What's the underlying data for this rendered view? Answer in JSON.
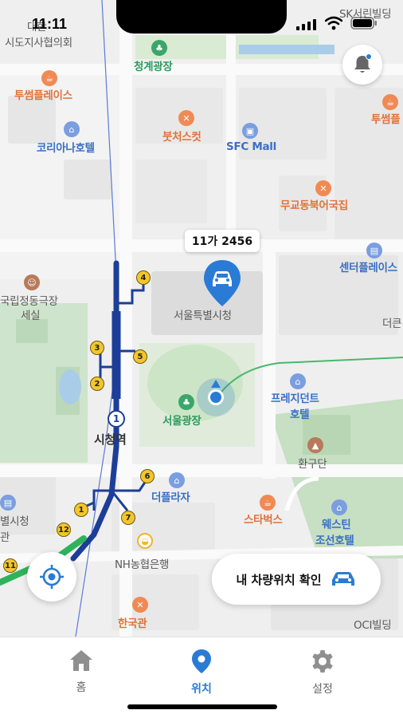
{
  "status_bar": {
    "time": "11:11"
  },
  "map": {
    "labels": {
      "daehan": "대한",
      "assoc": "시도지사협의회",
      "sk": "SK서린빌딩",
      "cheonggye": "청계광장",
      "tussom1": "투썸플레이스",
      "tussom2": "투썸플",
      "koreana": "코리아나호텔",
      "butcher": "붓처스컷",
      "sfc": "SFC Mall",
      "mugyo": "무교동북어국집",
      "center_place": "센터플레이스",
      "deoken": "더큰",
      "jeongdong1": "국립정동극장",
      "jeongdong2": "세실",
      "cityhall": "서울특별시청",
      "plaza": "서울광장",
      "station": "시청역",
      "line1": "1호선",
      "president1": "프레지던트",
      "president2": "호텔",
      "hwangudan": "환구단",
      "deplaza": "더플라자",
      "starbucks": "스타벅스",
      "westin1": "웨스틴",
      "westin2": "조선호텔",
      "cityhall_left1": "별시청",
      "cityhall_left2": "관",
      "nh": "NH농협은행",
      "hanguk": "한국관",
      "oci": "OCI빌딩"
    },
    "exits": [
      "4",
      "3",
      "5",
      "2",
      "6",
      "1",
      "7",
      "12",
      "11"
    ],
    "station_number": "1"
  },
  "car": {
    "plate": "11가 2456"
  },
  "actions": {
    "check_car_location": "내 차량위치 확인"
  },
  "nav": {
    "tabs": [
      {
        "label": "홈",
        "icon": "home-icon"
      },
      {
        "label": "위치",
        "icon": "location-pin-icon"
      },
      {
        "label": "설정",
        "icon": "gear-icon"
      }
    ],
    "active": "위치"
  },
  "colors": {
    "accent": "#2a7bd5",
    "subway": "#1c3e98",
    "route": "#2fb35a"
  }
}
